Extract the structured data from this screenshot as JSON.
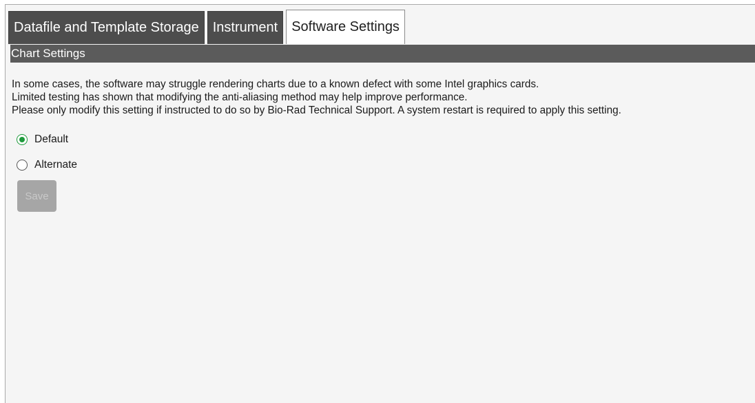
{
  "tabs": [
    {
      "label": "Datafile and Template Storage",
      "active": false
    },
    {
      "label": "Instrument",
      "active": false
    },
    {
      "label": "Software Settings",
      "active": true
    }
  ],
  "section": {
    "title": "Chart Settings",
    "description": [
      "In some cases, the software may struggle rendering charts due to a known defect with some Intel graphics cards.",
      "Limited testing has shown that modifying the anti-aliasing method may help improve performance.",
      "Please only modify this setting if instructed to do so by Bio-Rad Technical Support. A system restart is required to apply this setting."
    ],
    "options": [
      {
        "label": "Default",
        "selected": true
      },
      {
        "label": "Alternate",
        "selected": false
      }
    ],
    "save_label": "Save",
    "save_enabled": false
  },
  "colors": {
    "tab_inactive_bg": "#4d4d4d",
    "header_bg": "#5b5b5b",
    "radio_selected": "#1e9a3c",
    "page_bg": "#f5f5f5"
  }
}
